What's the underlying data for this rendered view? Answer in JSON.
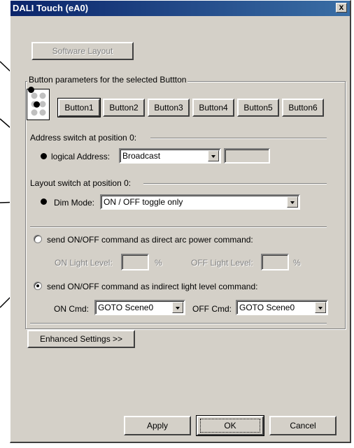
{
  "window": {
    "title": "DALI Touch (eA0)",
    "close_label": "x"
  },
  "software_layout_button": "Software Layout",
  "button_group": {
    "legend": "Button parameters for the selected Buttton",
    "buttons": [
      "Button1",
      "Button2",
      "Button3",
      "Button4",
      "Button5",
      "Button6"
    ],
    "selected": "Button1"
  },
  "address_section": {
    "heading": "Address switch at position 0:",
    "logical_address_label": "logical Address:",
    "logical_address_value": "Broadcast",
    "extra_value": ""
  },
  "layout_section": {
    "heading": "Layout switch at position 0:",
    "dim_mode_label": "Dim Mode:",
    "dim_mode_value": "ON / OFF toggle only"
  },
  "command_section": {
    "direct_label": "send ON/OFF command as direct arc power command:",
    "direct_selected": false,
    "on_light_level_label": "ON Light Level:",
    "on_light_level_value": "",
    "off_light_level_label": "OFF Light Level:",
    "off_light_level_value": "",
    "percent": "%",
    "indirect_label": "send ON/OFF command as indirect light level command:",
    "indirect_selected": true,
    "on_cmd_label": "ON Cmd:",
    "on_cmd_value": "GOTO Scene0",
    "off_cmd_label": "OFF Cmd:",
    "off_cmd_value": "GOTO Scene0"
  },
  "enhanced_settings_button": "Enhanced Settings >>",
  "footer": {
    "apply": "Apply",
    "ok": "OK",
    "cancel": "Cancel"
  }
}
